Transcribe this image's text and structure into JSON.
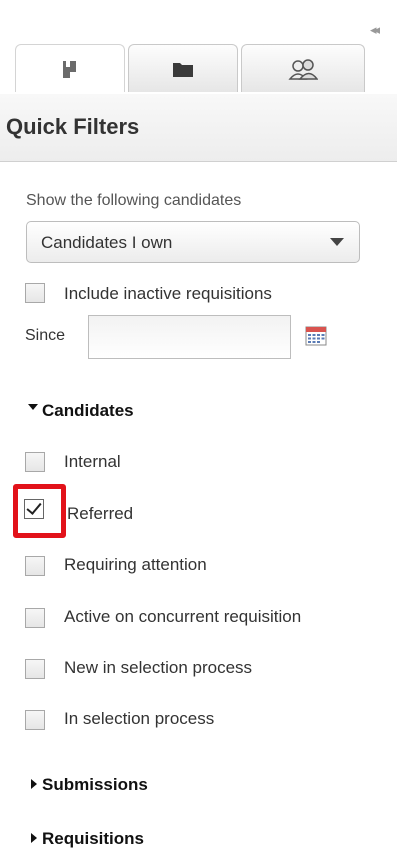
{
  "panel": {
    "collapse_glyph": "◂◂",
    "tabs": [
      {
        "icon": "person-icon",
        "active": true
      },
      {
        "icon": "folder-icon",
        "active": false
      },
      {
        "icon": "people-group-icon",
        "active": false
      }
    ]
  },
  "header": {
    "title": "Quick Filters"
  },
  "filters": {
    "show_label": "Show the following candidates",
    "show_select_value": "Candidates I own",
    "include_inactive_label": "Include inactive requisitions",
    "include_inactive_checked": false,
    "since_label": "Since",
    "since_value": ""
  },
  "sections": {
    "candidates": {
      "title": "Candidates",
      "expanded": true,
      "items": [
        {
          "label": "Internal",
          "checked": false
        },
        {
          "label": "Referred",
          "checked": true
        },
        {
          "label": "Requiring attention",
          "checked": false
        },
        {
          "label": "Active on concurrent requisition",
          "checked": false
        },
        {
          "label": "New in selection process",
          "checked": false
        },
        {
          "label": "In selection process",
          "checked": false
        }
      ]
    },
    "submissions": {
      "title": "Submissions",
      "expanded": false
    },
    "requisitions": {
      "title": "Requisitions",
      "expanded": false
    }
  },
  "colors": {
    "highlight": "#e2121a"
  }
}
